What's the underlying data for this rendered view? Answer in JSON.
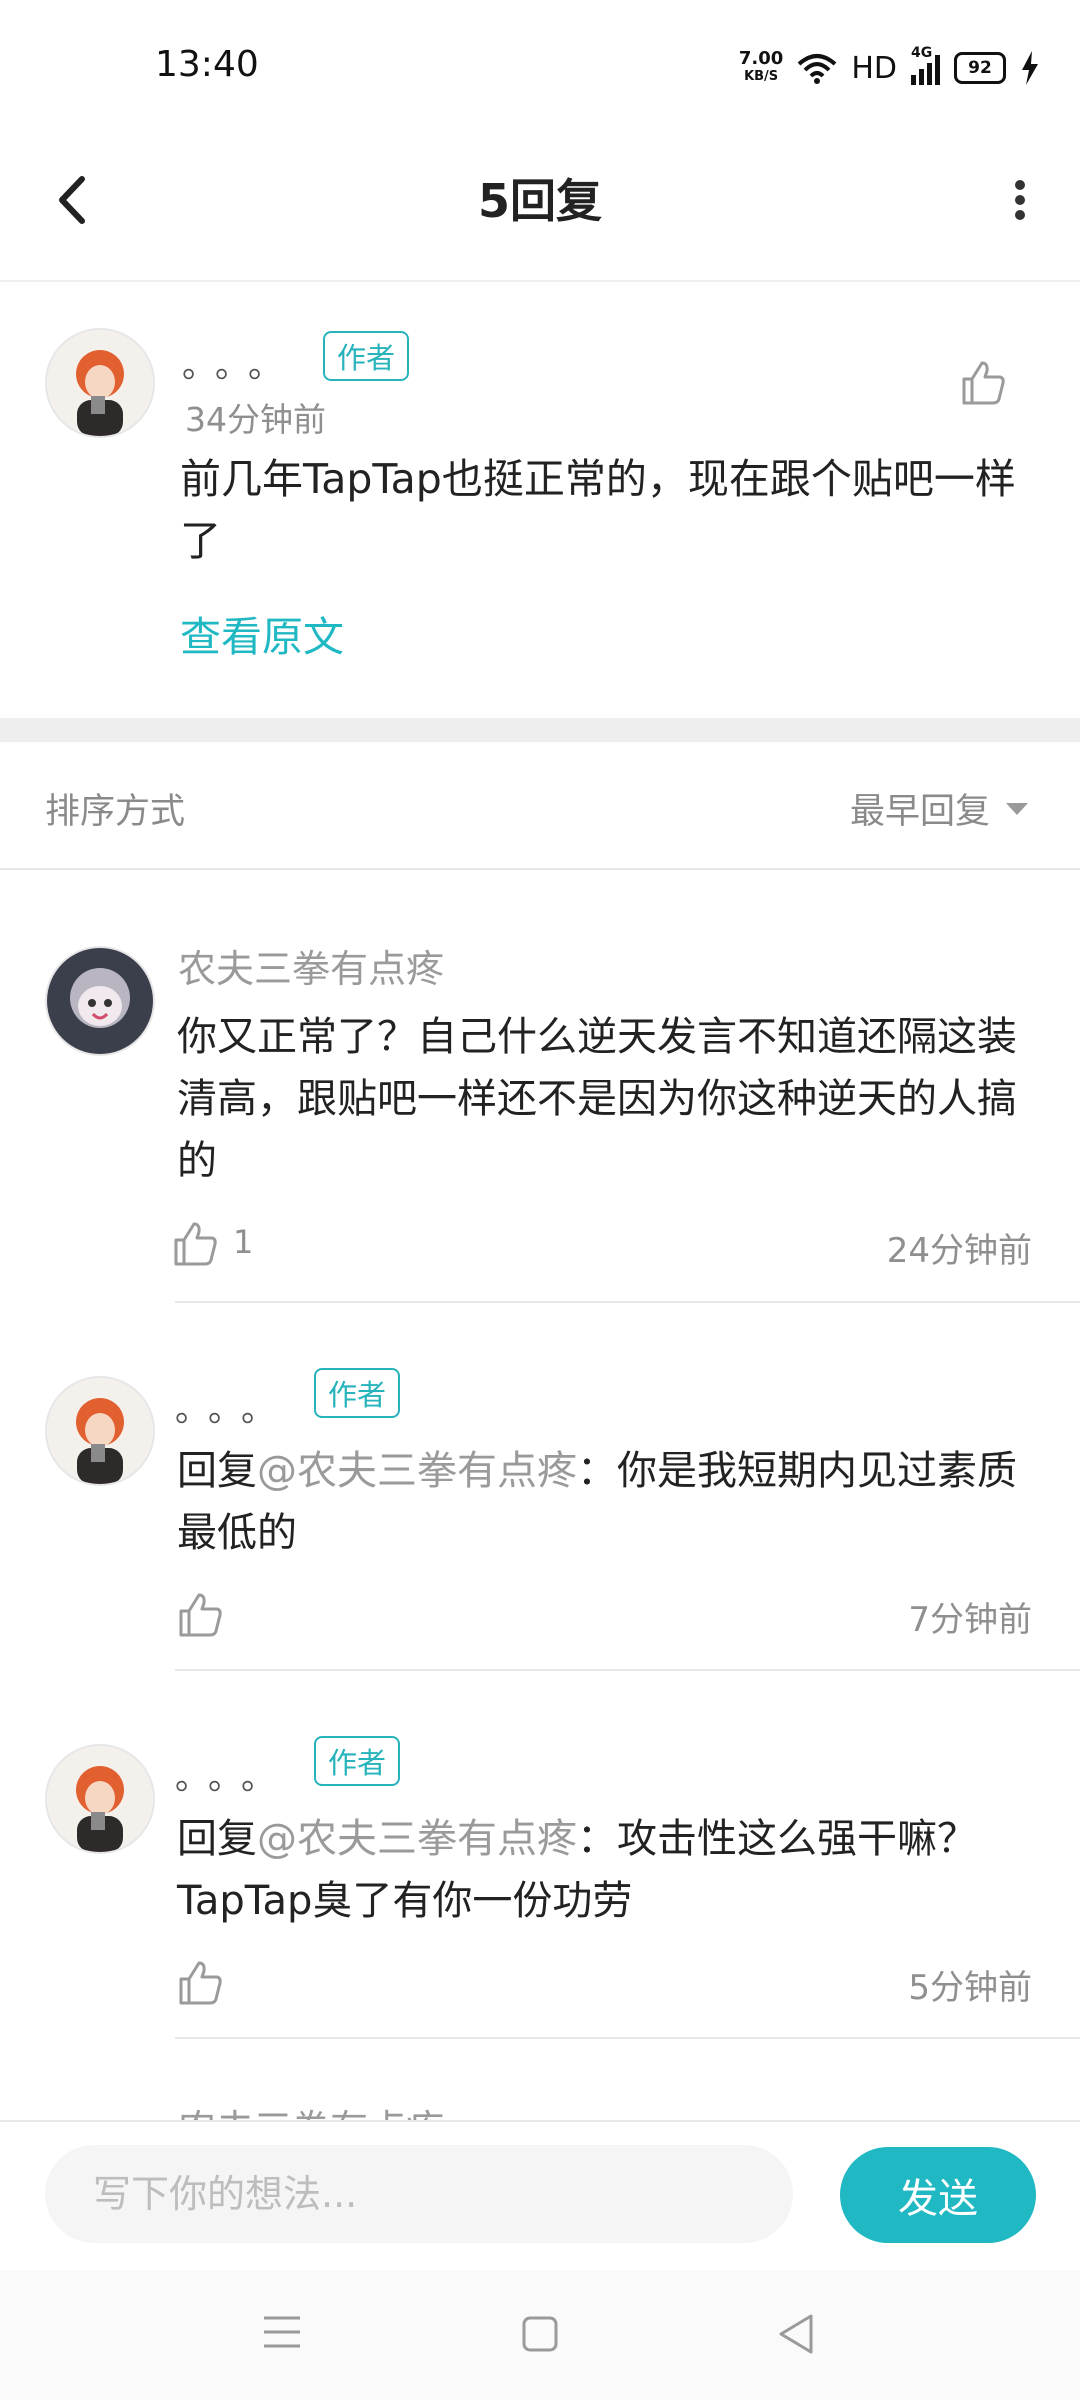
{
  "status_bar": {
    "time": "13:40",
    "net_speed_value": "7.00",
    "net_speed_unit": "KB/S",
    "hd": "HD",
    "network": "4G",
    "battery": "92"
  },
  "header": {
    "title": "5回复"
  },
  "original_comment": {
    "user_name": "。。。",
    "badge": "作者",
    "time": "34分钟前",
    "text": "前几年TapTap也挺正常的，现在跟个贴吧一样了",
    "view_original": "查看原文"
  },
  "sort": {
    "label": "排序方式",
    "value": "最早回复"
  },
  "replies": [
    {
      "user_name": "农夫三拳有点疼",
      "text": "你又正常了？自己什么逆天发言不知道还隔这装清高，跟贴吧一样还不是因为你这种逆天的人搞的",
      "likes": "1",
      "time": "24分钟前"
    },
    {
      "user_name": "。。。",
      "badge": "作者",
      "reply_prefix": "回复",
      "mention": "@农夫三拳有点疼",
      "text": "：你是我短期内见过素质最低的",
      "time": "7分钟前"
    },
    {
      "user_name": "。。。",
      "badge": "作者",
      "reply_prefix": "回复",
      "mention": "@农夫三拳有点疼",
      "text": "：攻击性这么强干嘛？TapTap臭了有你一份功劳",
      "time": "5分钟前"
    },
    {
      "user_name": "农夫三拳有点疼"
    }
  ],
  "composer": {
    "placeholder": "写下你的想法...",
    "send_label": "发送"
  },
  "colors": {
    "accent": "#1fb8c3",
    "author_badge": "#26b3bb",
    "muted": "#9a9a9a"
  }
}
